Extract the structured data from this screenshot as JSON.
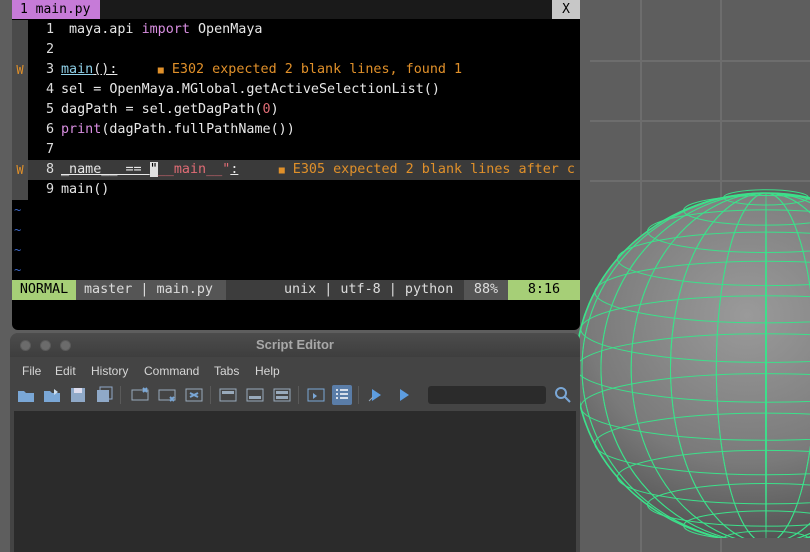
{
  "vim": {
    "tab_label": "1 main.py",
    "tab_close": "X",
    "lines": [
      {
        "num": "1",
        "sign": "",
        "parts": [
          [
            "maya.api ",
            ""
          ],
          [
            "import",
            "kw"
          ],
          [
            " OpenMaya",
            ""
          ]
        ],
        "lint": ""
      },
      {
        "num": "2",
        "sign": "",
        "parts": [],
        "lint": ""
      },
      {
        "num": "3",
        "sign": "W",
        "parts": [
          [
            "main",
            "fn-ul"
          ],
          [
            "():",
            "wavy"
          ]
        ],
        "lint": "E302 expected 2 blank lines, found 1"
      },
      {
        "num": "4",
        "sign": "",
        "parts": [
          [
            "sel = OpenMaya.MGlobal.getActiveSelectionList()",
            ""
          ]
        ],
        "lint": ""
      },
      {
        "num": "5",
        "sign": "",
        "parts": [
          [
            "dagPath = sel.getDagPath(",
            ""
          ],
          [
            "0",
            "num"
          ],
          [
            ")",
            ""
          ]
        ],
        "lint": ""
      },
      {
        "num": "6",
        "sign": "",
        "parts": [
          [
            "print",
            "kw"
          ],
          [
            "(dagPath.fullPathName())",
            ""
          ]
        ],
        "lint": ""
      },
      {
        "num": "7",
        "sign": "",
        "parts": [],
        "lint": ""
      },
      {
        "num": "8",
        "sign": "W",
        "parts": [
          [
            "_name__ == ",
            "wavy"
          ],
          [
            "\"",
            "cursor"
          ],
          [
            "__main__\"",
            "str"
          ],
          [
            ":",
            "wavy"
          ]
        ],
        "lint": "E305 expected 2 blank lines after c"
      },
      {
        "num": "9",
        "sign": "",
        "parts": [
          [
            "main()",
            ""
          ]
        ],
        "lint": ""
      }
    ],
    "empty_line_marker": "~",
    "status": {
      "mode": "NORMAL",
      "branch_file": "master | main.py",
      "fileinfo": "unix | utf-8 | python",
      "percent": "88%",
      "position": "8:16"
    }
  },
  "script_editor": {
    "title": "Script Editor",
    "menus": [
      "File",
      "Edit",
      "History",
      "Command",
      "Tabs",
      "Help"
    ]
  },
  "colors": {
    "tab_active": "#c67bd8",
    "mode_bg": "#a6cf77",
    "lint": "#e0902a",
    "keyword": "#d88ee0",
    "wireframe": "#3ce08a"
  },
  "icons": [
    "open-script-icon",
    "source-script-icon",
    "save-script-icon",
    "save-all-icon",
    "clear-history-icon",
    "clear-input-icon",
    "clear-all-icon",
    "show-history-icon",
    "show-input-icon",
    "show-both-icon",
    "echo-commands-icon",
    "line-numbers-icon",
    "execute-all-icon",
    "execute-icon",
    "search-icon"
  ]
}
